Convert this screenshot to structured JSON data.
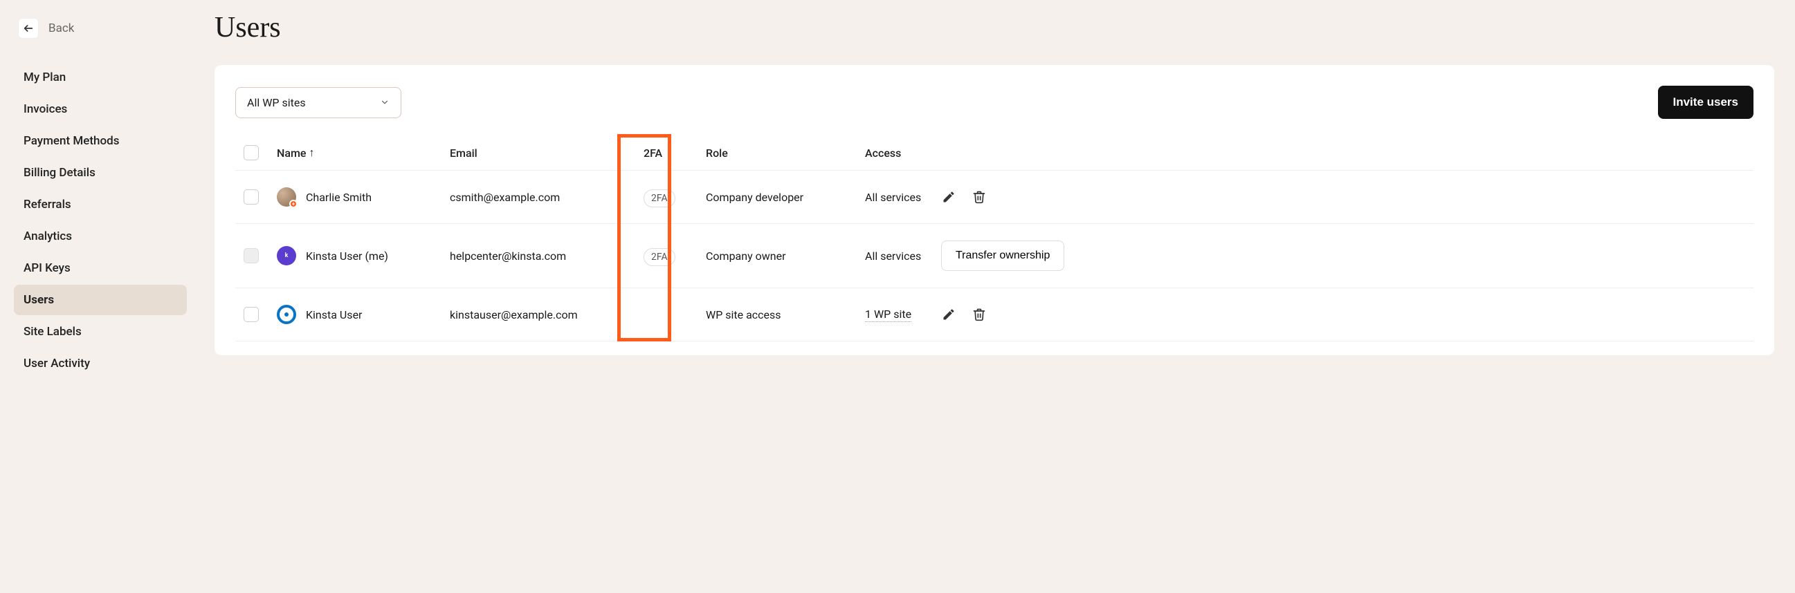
{
  "back_label": "Back",
  "page_title": "Users",
  "sidebar": {
    "items": [
      {
        "label": "My Plan"
      },
      {
        "label": "Invoices"
      },
      {
        "label": "Payment Methods"
      },
      {
        "label": "Billing Details"
      },
      {
        "label": "Referrals"
      },
      {
        "label": "Analytics"
      },
      {
        "label": "API Keys"
      },
      {
        "label": "Users",
        "active": true
      },
      {
        "label": "Site Labels"
      },
      {
        "label": "User Activity"
      }
    ]
  },
  "toolbar": {
    "filter_label": "All WP sites",
    "invite_label": "Invite users"
  },
  "table": {
    "columns": {
      "name": "Name",
      "email": "Email",
      "twofa": "2FA",
      "role": "Role",
      "access": "Access"
    },
    "rows": [
      {
        "name": "Charlie Smith",
        "email": "csmith@example.com",
        "twofa": "2FA",
        "role": "Company developer",
        "access": "All services",
        "avatar": "person",
        "badge": true,
        "checkbox_disabled": false,
        "actions": "edit-delete"
      },
      {
        "name": "Kinsta User (me)",
        "email": "helpcenter@kinsta.com",
        "twofa": "2FA",
        "role": "Company owner",
        "access": "All services",
        "avatar": "purple",
        "checkbox_disabled": true,
        "actions": "transfer"
      },
      {
        "name": "Kinsta User",
        "email": "kinstauser@example.com",
        "twofa": "",
        "role": "WP site access",
        "access": "1 WP site",
        "access_link": true,
        "avatar": "blue-ring",
        "checkbox_disabled": false,
        "actions": "edit-delete"
      }
    ]
  },
  "transfer_label": "Transfer ownership"
}
